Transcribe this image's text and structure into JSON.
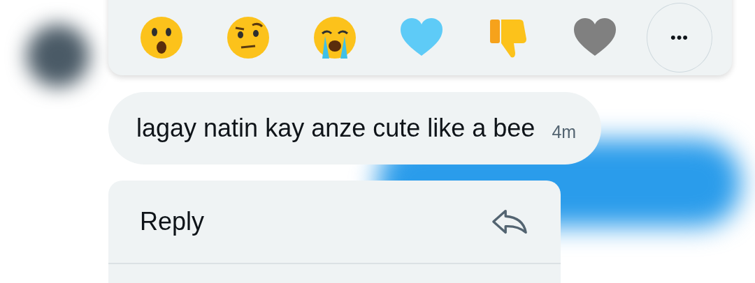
{
  "reactions": [
    {
      "kind": "astonished"
    },
    {
      "kind": "raised-eyebrow"
    },
    {
      "kind": "crying"
    },
    {
      "kind": "heart",
      "color": "#5ecbf7"
    },
    {
      "kind": "thumbs-down"
    },
    {
      "kind": "heart",
      "color": "#808080"
    }
  ],
  "more_button": {
    "label": "•••"
  },
  "message": {
    "text": "lagay natin kay anze cute like a bee",
    "time": "4m"
  },
  "menu": {
    "items": [
      {
        "kind": "reply",
        "label": "Reply"
      }
    ]
  }
}
